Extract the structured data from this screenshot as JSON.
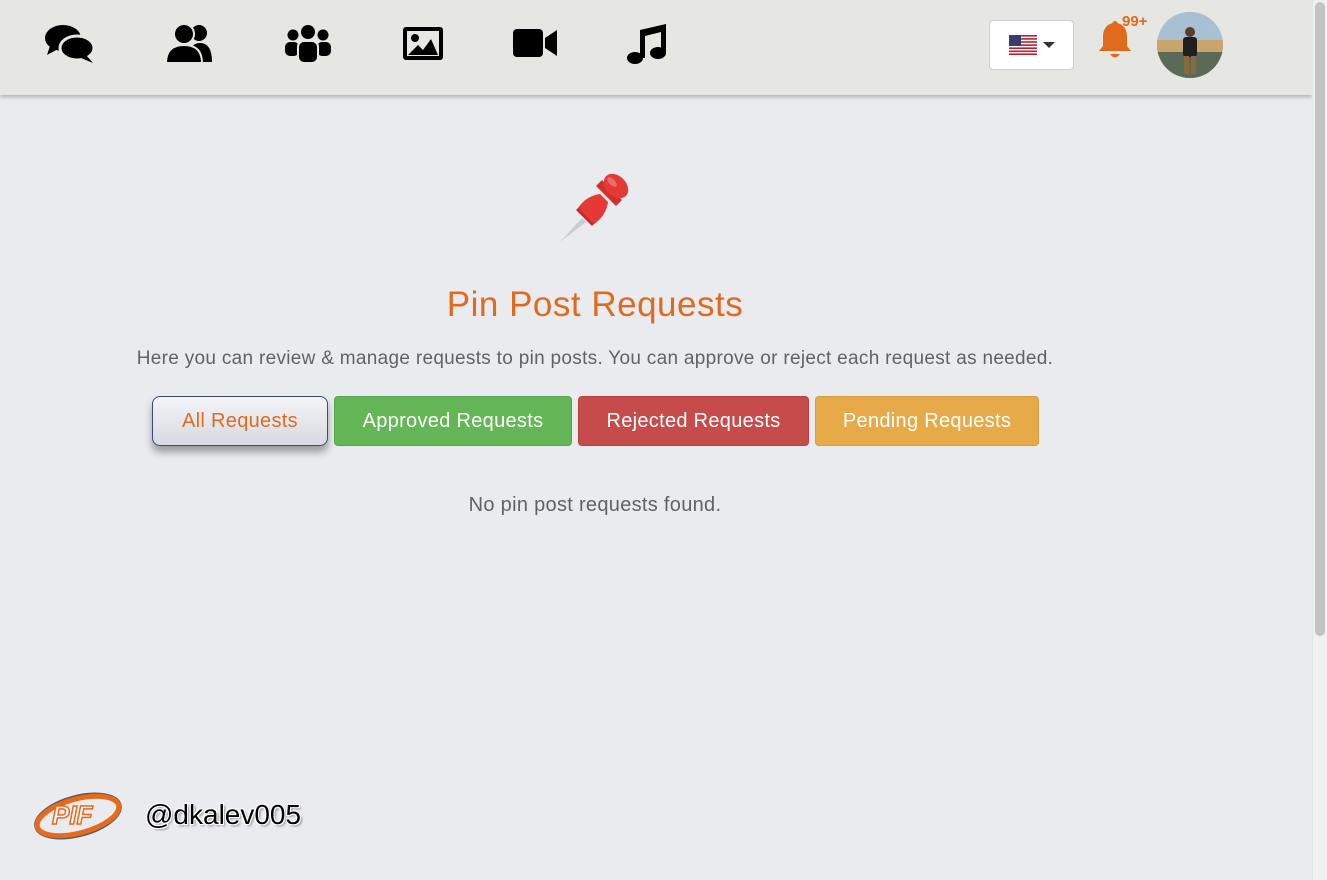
{
  "nav": {
    "items": [
      {
        "name": "chat-icon"
      },
      {
        "name": "friends-icon"
      },
      {
        "name": "groups-icon"
      },
      {
        "name": "photos-icon"
      },
      {
        "name": "videos-icon"
      },
      {
        "name": "music-icon"
      }
    ],
    "language": {
      "selected": "US English flag"
    },
    "notifications": {
      "count": "99+",
      "color": "#e06a1b"
    }
  },
  "main": {
    "icon": "pushpin-icon",
    "title": "Pin Post Requests",
    "description": "Here you can review & manage requests to pin posts. You can approve or reject each request as needed.",
    "tabs": [
      {
        "label": "All Requests",
        "active": true
      },
      {
        "label": "Approved Requests",
        "color": "#65b657"
      },
      {
        "label": "Rejected Requests",
        "color": "#c64b4b"
      },
      {
        "label": "Pending Requests",
        "color": "#e6aa48"
      }
    ],
    "empty_message": "No pin post requests found."
  },
  "footer": {
    "logo_text": "PIF",
    "handle": "@dkalev005"
  },
  "colors": {
    "accent": "#dd6b20",
    "background": "#e9ebee",
    "topbar": "#e6e7e2"
  }
}
